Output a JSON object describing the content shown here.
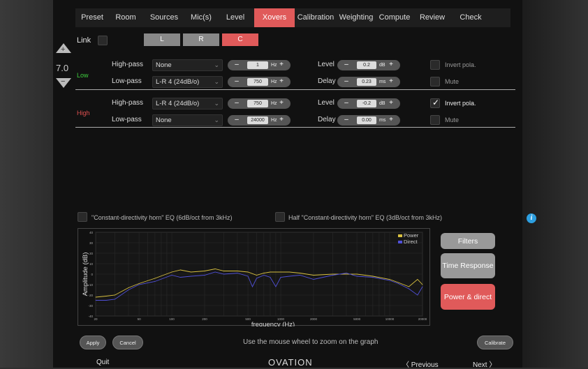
{
  "nav": {
    "tabs": [
      {
        "label": "Preset",
        "active": false
      },
      {
        "label": "Room",
        "active": false
      },
      {
        "label": "Sources",
        "active": false
      },
      {
        "label": "Mic(s)",
        "active": false
      },
      {
        "label": "Level",
        "active": false
      },
      {
        "label": "Xovers",
        "active": true
      },
      {
        "label": "Calibration",
        "active": false
      },
      {
        "label": "Weighting",
        "active": false
      },
      {
        "label": "Compute",
        "active": false
      },
      {
        "label": "Review",
        "active": false
      },
      {
        "label": "Check",
        "active": false
      }
    ]
  },
  "level_control": {
    "up_symbol": "+",
    "value": "7.0",
    "down_symbol": "−"
  },
  "link": {
    "label": "Link",
    "checked": false
  },
  "channels": [
    {
      "label": "L",
      "active": false
    },
    {
      "label": "R",
      "active": false
    },
    {
      "label": "C",
      "active": true
    }
  ],
  "groups": [
    {
      "name": "Low",
      "color": "#3fd03f",
      "rows": [
        {
          "filter_label": "High-pass",
          "filter_type": "None",
          "freq": "1",
          "freq_unit": "Hz",
          "param_label": "Level",
          "param_value": "0.2",
          "param_unit": "dB",
          "option_label": "Invert pola.",
          "option_checked": false
        },
        {
          "filter_label": "Low-pass",
          "filter_type": "L-R 4 (24dB/o)",
          "freq": "750",
          "freq_unit": "Hz",
          "param_label": "Delay",
          "param_value": "0.23",
          "param_unit": "ms",
          "option_label": "Mute",
          "option_checked": false
        }
      ]
    },
    {
      "name": "High",
      "color": "#e05050",
      "rows": [
        {
          "filter_label": "High-pass",
          "filter_type": "L-R 4 (24dB/o)",
          "freq": "750",
          "freq_unit": "Hz",
          "param_label": "Level",
          "param_value": "-0.2",
          "param_unit": "dB",
          "option_label": "Invert pola.",
          "option_checked": true
        },
        {
          "filter_label": "Low-pass",
          "filter_type": "None",
          "freq": "24000",
          "freq_unit": "Hz",
          "param_label": "Delay",
          "param_value": "0.00",
          "param_unit": "ms",
          "option_label": "Mute",
          "option_checked": false
        }
      ]
    }
  ],
  "eq_options": {
    "cd_horn": "\"Constant-directivity horn\" EQ (6dB/oct from 3kHz)",
    "half_cd_horn": "Half \"Constant-directivity horn\" EQ (3dB/oct from 3kHz)"
  },
  "side_buttons": {
    "filters": "Filters",
    "time_response": "Time Response",
    "power_direct": "Power & direct"
  },
  "actions": {
    "apply": "Apply",
    "cancel": "Cancel",
    "calibrate": "Calibrate",
    "info_symbol": "i"
  },
  "hint": "Use the mouse wheel to zoom on the graph",
  "footer": {
    "quit": "Quit",
    "logo": "OVATION",
    "previous": "〈  Previous",
    "next": "Next  〉"
  },
  "colors": {
    "accent": "#e05a5a",
    "power": "#d8c040",
    "direct": "#5050d8"
  },
  "chart_data": {
    "type": "line",
    "xlabel": "frequency (Hz)",
    "ylabel": "Amplitude (dB)",
    "xscale": "log",
    "xlim": [
      20,
      20000
    ],
    "ylim": [
      -40,
      40
    ],
    "x_ticks": [
      "20",
      "50",
      "100",
      "200",
      "500",
      "1000",
      "2000",
      "5000",
      "10000",
      "20000"
    ],
    "y_ticks": [
      "40",
      "30",
      "20",
      "10",
      "0",
      "-10",
      "-20",
      "-30",
      "-40"
    ],
    "legend": "top-right",
    "grid": true,
    "series": [
      {
        "name": "Power",
        "color": "#d8c040",
        "x": [
          20,
          25,
          30,
          40,
          50,
          70,
          100,
          120,
          150,
          200,
          250,
          300,
          400,
          500,
          600,
          700,
          800,
          1000,
          1200,
          1500,
          2000,
          3000,
          4000,
          5000,
          7000,
          10000,
          12000,
          15000,
          18000,
          20000
        ],
        "y": [
          -22,
          -21,
          -20,
          -13,
          -9,
          -4,
          2,
          4,
          2,
          3,
          5,
          3,
          3,
          2,
          -1,
          1,
          2,
          2,
          2,
          1,
          -1,
          0,
          0,
          0,
          -2,
          -5,
          -8,
          -12,
          -5,
          -10
        ]
      },
      {
        "name": "Direct",
        "color": "#5050d8",
        "x": [
          20,
          25,
          30,
          40,
          50,
          70,
          100,
          120,
          150,
          200,
          250,
          300,
          400,
          500,
          550,
          600,
          700,
          800,
          900,
          1000,
          1200,
          1500,
          2000,
          3000,
          4000,
          5000,
          7000,
          10000,
          12000,
          15000,
          18000,
          20000
        ],
        "y": [
          -25,
          -25,
          -24,
          -15,
          -10,
          -7,
          -1,
          -3,
          -2,
          -1,
          2,
          0,
          1,
          -2,
          -12,
          -4,
          -1,
          -3,
          -12,
          -3,
          -2,
          -1,
          -5,
          -1,
          1,
          -2,
          -3,
          -6,
          -9,
          -14,
          -20,
          -12
        ]
      }
    ]
  }
}
